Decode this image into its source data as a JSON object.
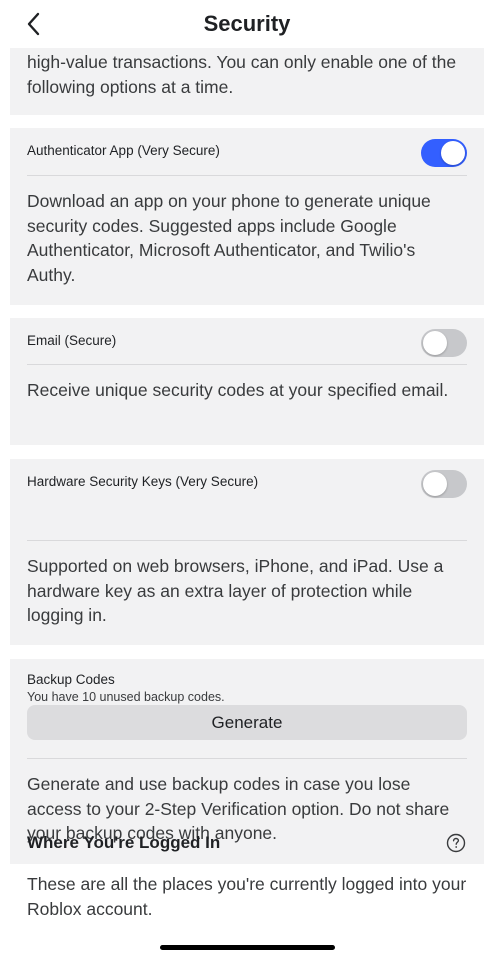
{
  "header": {
    "title": "Security"
  },
  "intro": {
    "text": "high-value transactions. You can only enable one of the following options at a time."
  },
  "options": [
    {
      "label": "Authenticator App (Very Secure)",
      "enabled": true,
      "description": "Download an app on your phone to generate unique security codes. Suggested apps include Google Authenticator, Microsoft Authenticator, and Twilio's Authy."
    },
    {
      "label": "Email (Secure)",
      "enabled": false,
      "description": "Receive unique security codes at your specified email."
    },
    {
      "label": "Hardware Security Keys (Very Secure)",
      "enabled": false,
      "description": "Supported on web browsers, iPhone, and iPad. Use a hardware key as an extra layer of protection while logging in."
    }
  ],
  "backup": {
    "label": "Backup Codes",
    "subtext": "You have 10 unused backup codes.",
    "button_label": "Generate",
    "description": "Generate and use backup codes in case you lose access to your 2-Step Verification option. Do not share your backup codes with anyone."
  },
  "logged_in": {
    "title": "Where You're Logged In",
    "description": "These are all the places you're currently logged into your Roblox account."
  },
  "colors": {
    "accent": "#335fff",
    "card_bg": "#f2f2f3",
    "toggle_off": "#c7c8cb"
  },
  "icons": {
    "back": "chevron-left-icon",
    "help": "question-circle-icon"
  }
}
